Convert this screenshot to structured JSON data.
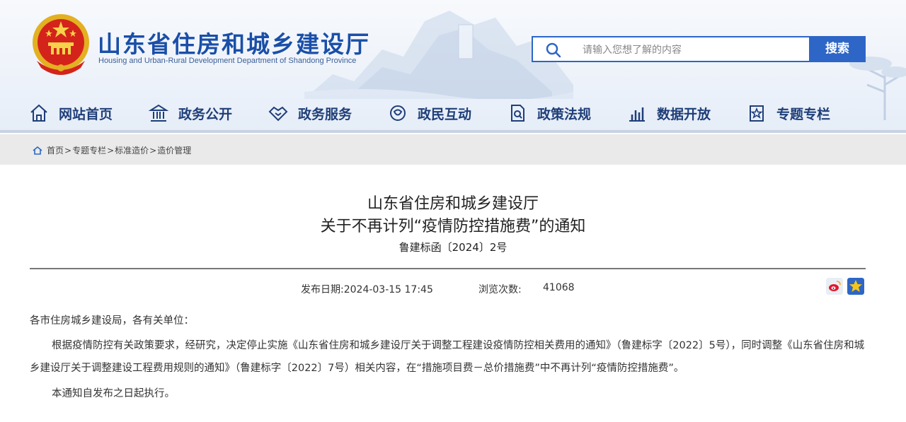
{
  "header": {
    "title": "山东省住房和城乡建设厅",
    "subtitle": "Housing and Urban-Rural Development Department of Shandong Province",
    "emblem_icon": "national-emblem",
    "search": {
      "placeholder": "请输入您想了解的内容",
      "button_label": "搜索",
      "icon": "search-icon"
    }
  },
  "nav": {
    "items": [
      {
        "label": "网站首页",
        "icon": "home-icon"
      },
      {
        "label": "政务公开",
        "icon": "building-icon"
      },
      {
        "label": "政务服务",
        "icon": "handshake-icon"
      },
      {
        "label": "政民互动",
        "icon": "interaction-icon"
      },
      {
        "label": "政策法规",
        "icon": "document-icon"
      },
      {
        "label": "数据开放",
        "icon": "bar-chart-icon"
      },
      {
        "label": "专题专栏",
        "icon": "star-badge-icon"
      }
    ]
  },
  "breadcrumb": {
    "items": [
      "首页",
      "专题专栏",
      "标准造价",
      "造价管理"
    ],
    "separator": ">"
  },
  "article": {
    "title_line1": "山东省住房和城乡建设厅",
    "title_line2": "关于不再计列“疫情防控措施费”的通知",
    "doc_number": "鲁建标函〔2024〕2号",
    "publish_date": "发布日期:2024-03-15 17:45",
    "views_label": "浏览次数:",
    "views_count": "41068",
    "share_icons": [
      "weibo-icon",
      "favorite-star-icon"
    ],
    "salutation": "各市住房城乡建设局，各有关单位：",
    "paragraph1": "根据疫情防控有关政策要求，经研究，决定停止实施《山东省住房和城乡建设厅关于调整工程建设疫情防控相关费用的通知》（鲁建标字〔2022〕5号），同时调整《山东省住房和城乡建设厅关于调整建设工程费用规则的通知》（鲁建标字〔2022〕7号）相关内容，在“措施项目费－总价措施费”中不再计列“疫情防控措施费”。",
    "paragraph2": "本通知自发布之日起执行。"
  },
  "colors": {
    "brand_blue": "#1a4fa8",
    "search_blue": "#2d66c6",
    "nav_text": "#1f3e78",
    "breadcrumb_bg": "#eaeaea"
  }
}
